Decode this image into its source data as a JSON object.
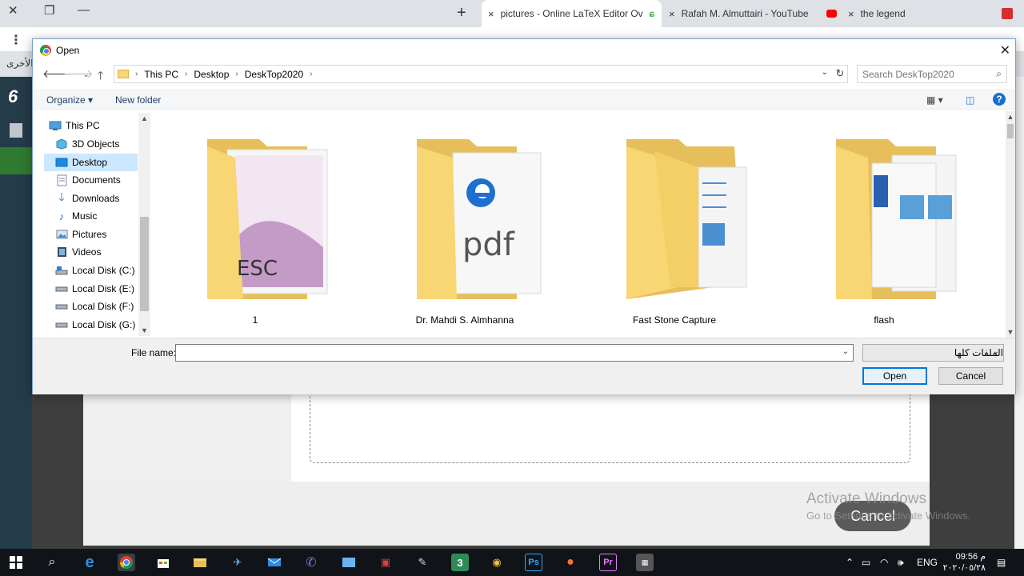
{
  "browser": {
    "tabs": [
      {
        "title": "pictures - Online LaTeX Editor Ov",
        "close": "×",
        "icon": "overleaf-icon"
      },
      {
        "title": "Rafah M. Almuttairi - YouTube",
        "close": "×",
        "icon": "youtube-icon"
      },
      {
        "title": "the legend",
        "close": "×",
        "icon": "legend-icon"
      }
    ],
    "new_tab": "+",
    "window_close": "✕",
    "window_restore": "❐",
    "window_minimize": "—",
    "menu": "⋮",
    "arabic_fragment": "الأخرى"
  },
  "webpage": {
    "cancel_label": "Cancel",
    "watermark_line1": "Activate Windows",
    "watermark_line2": "Go to Settings to activate Windows."
  },
  "dialog": {
    "title": "Open",
    "close": "✕",
    "breadcrumb": [
      "This PC",
      "Desktop",
      "DeskTop2020"
    ],
    "search_placeholder": "Search DeskTop2020",
    "organize_label": "Organize ▾",
    "new_folder_label": "New folder",
    "help": "?",
    "nav_items": [
      {
        "label": "This PC",
        "icon": "pc-icon"
      },
      {
        "label": "3D Objects",
        "icon": "cube-icon"
      },
      {
        "label": "Desktop",
        "icon": "desktop-icon",
        "selected": true
      },
      {
        "label": "Documents",
        "icon": "documents-icon"
      },
      {
        "label": "Downloads",
        "icon": "download-icon"
      },
      {
        "label": "Music",
        "icon": "music-icon"
      },
      {
        "label": "Pictures",
        "icon": "pictures-icon"
      },
      {
        "label": "Videos",
        "icon": "video-icon"
      },
      {
        "label": "Local Disk (C:)",
        "icon": "disk-icon"
      },
      {
        "label": "Local Disk (E:)",
        "icon": "drive-icon"
      },
      {
        "label": "Local Disk (F:)",
        "icon": "drive-icon"
      },
      {
        "label": "Local Disk (G:)",
        "icon": "drive-icon"
      }
    ],
    "folders": [
      {
        "name": "1",
        "preview": "ESC"
      },
      {
        "name": "Dr. Mahdi S. Almhanna",
        "preview": "pdf"
      },
      {
        "name": "Fast Stone Capture",
        "preview": ""
      },
      {
        "name": "flash",
        "preview": ""
      }
    ],
    "file_name_label": "File name:",
    "file_name_value": "",
    "file_type": "الملفات كلها",
    "open_label": "Open",
    "cancel_label": "Cancel"
  },
  "taskbar": {
    "language": "ENG",
    "time": "09:56 م",
    "date": "٢٠٢٠/٠٥/٢٨"
  },
  "colors": {
    "selection": "#cce8ff",
    "accent": "#0078d7",
    "folder": "#f7d673"
  }
}
